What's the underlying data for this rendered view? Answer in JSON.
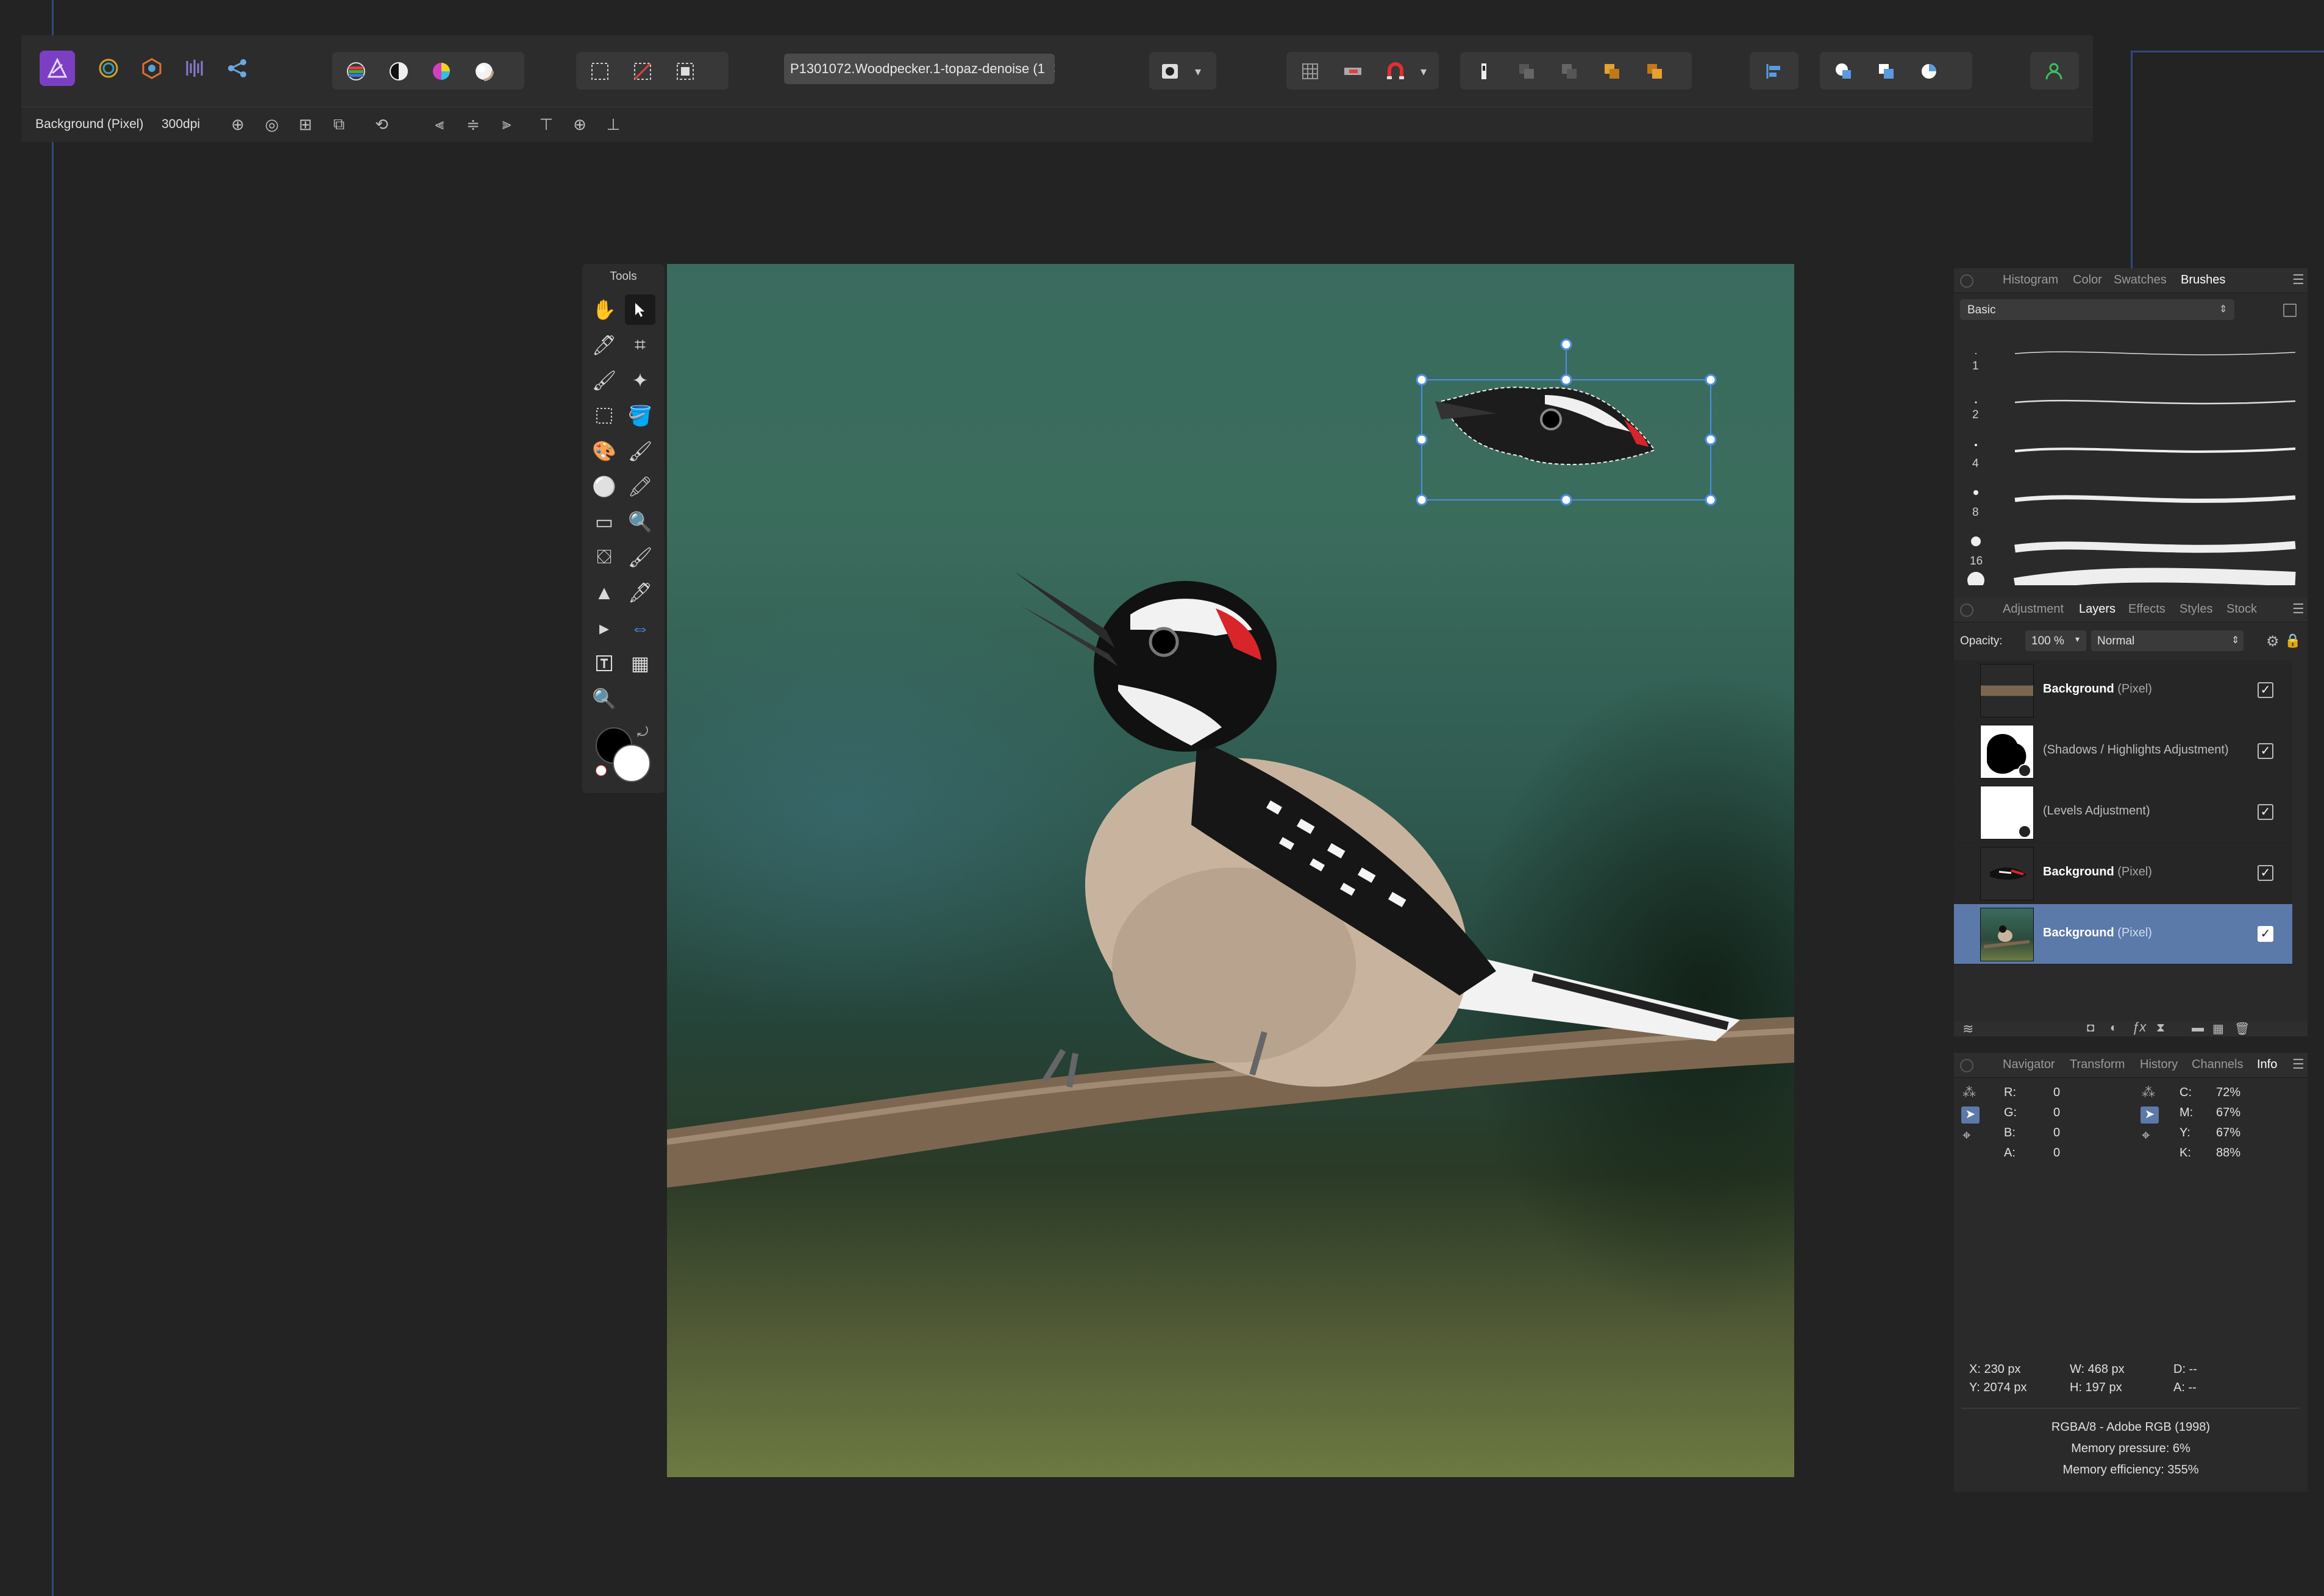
{
  "toolbar": {
    "document_tab": "P1301072.Woodpecker.1-topaz-denoise (1",
    "document_tab_close": "✕",
    "personas": [
      "photo-persona-icon",
      "liquify-persona-icon",
      "develop-persona-icon",
      "tone-mapping-persona-icon",
      "export-persona-icon"
    ]
  },
  "context": {
    "layer_type": "Background (Pixel)",
    "dpi": "300dpi"
  },
  "tools": {
    "title": "Tools"
  },
  "brushes_panel": {
    "tabs": [
      "Histogram",
      "Color",
      "Swatches",
      "Brushes"
    ],
    "active_tab": "Brushes",
    "category": "Basic",
    "sizes": [
      "1",
      "2",
      "4",
      "8",
      "16",
      ""
    ]
  },
  "layers_panel": {
    "tabs": [
      "Adjustment",
      "Layers",
      "Effects",
      "Styles",
      "Stock"
    ],
    "active_tab": "Layers",
    "opacity_label": "Opacity:",
    "opacity_value": "100 %",
    "blend_mode": "Normal",
    "layers": [
      {
        "name": "Background",
        "kind": "(Pixel)",
        "visible": true
      },
      {
        "name": "(Shadows / Highlights Adjustment)",
        "kind": "",
        "visible": true
      },
      {
        "name": "(Levels Adjustment)",
        "kind": "",
        "visible": true
      },
      {
        "name": "Background",
        "kind": "(Pixel)",
        "visible": true
      },
      {
        "name": "Background",
        "kind": "(Pixel)",
        "visible": true,
        "selected": true
      }
    ]
  },
  "info_panel": {
    "tabs": [
      "Navigator",
      "Transform",
      "History",
      "Channels",
      "Info"
    ],
    "active_tab": "Info",
    "rgba": {
      "R": "0",
      "G": "0",
      "B": "0",
      "A": "0"
    },
    "cmyk": {
      "C": "72%",
      "M": "67%",
      "Y": "67%",
      "K": "88%"
    },
    "x": "X: 230 px",
    "y": "Y: 2074 px",
    "w": "W: 468 px",
    "h": "H: 197 px",
    "d": "D: --",
    "a": "A: --",
    "color_format": "RGBA/8 - Adobe RGB (1998)",
    "memory_pressure": "Memory pressure: 6%",
    "memory_efficiency": "Memory efficiency: 355%"
  },
  "colors": {
    "accent": "#5b79a9",
    "selection_handle": "#4c8ee8",
    "panel_bg": "#2a2a2a",
    "app_bg": "#232323"
  }
}
